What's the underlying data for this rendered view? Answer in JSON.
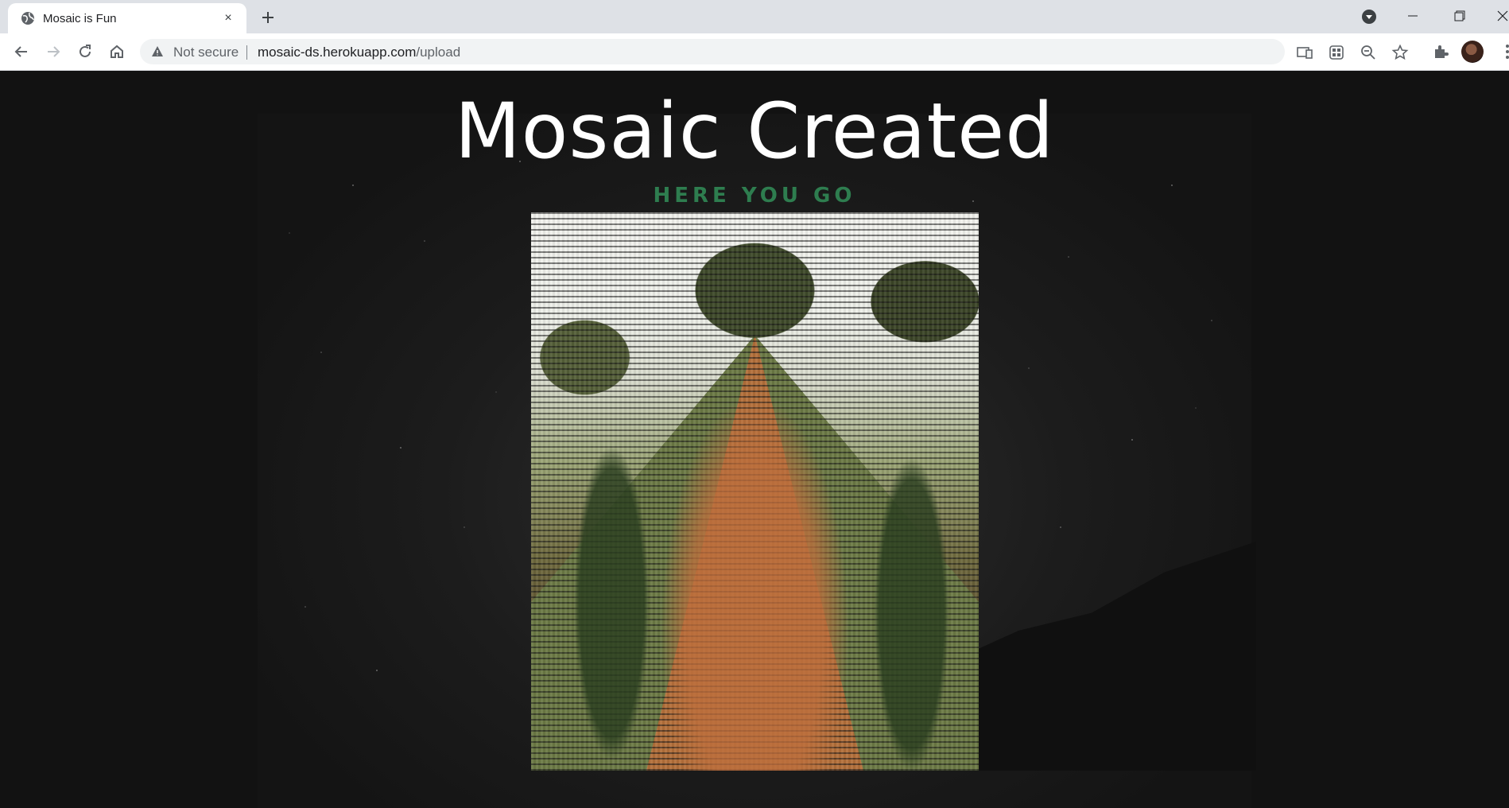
{
  "browser": {
    "tab_title": "Mosaic is Fun",
    "close_glyph": "×",
    "security_label": "Not secure",
    "url_host": "mosaic-ds.herokuapp.com",
    "url_path": "/upload",
    "icons": [
      "globe-icon",
      "close-icon",
      "plus-icon",
      "tab-search-icon",
      "minimize-icon",
      "restore-icon",
      "window-close-icon",
      "back-icon",
      "forward-icon",
      "reload-icon",
      "home-icon",
      "warning-icon",
      "install-icon",
      "qr-icon",
      "zoom-out-icon",
      "star-icon",
      "extensions-icon",
      "avatar"
    ]
  },
  "page": {
    "title": "Mosaic Created",
    "subtitle": "HERE YOU GO",
    "accent_color": "#2e7d4f",
    "background_color": "#121212"
  }
}
